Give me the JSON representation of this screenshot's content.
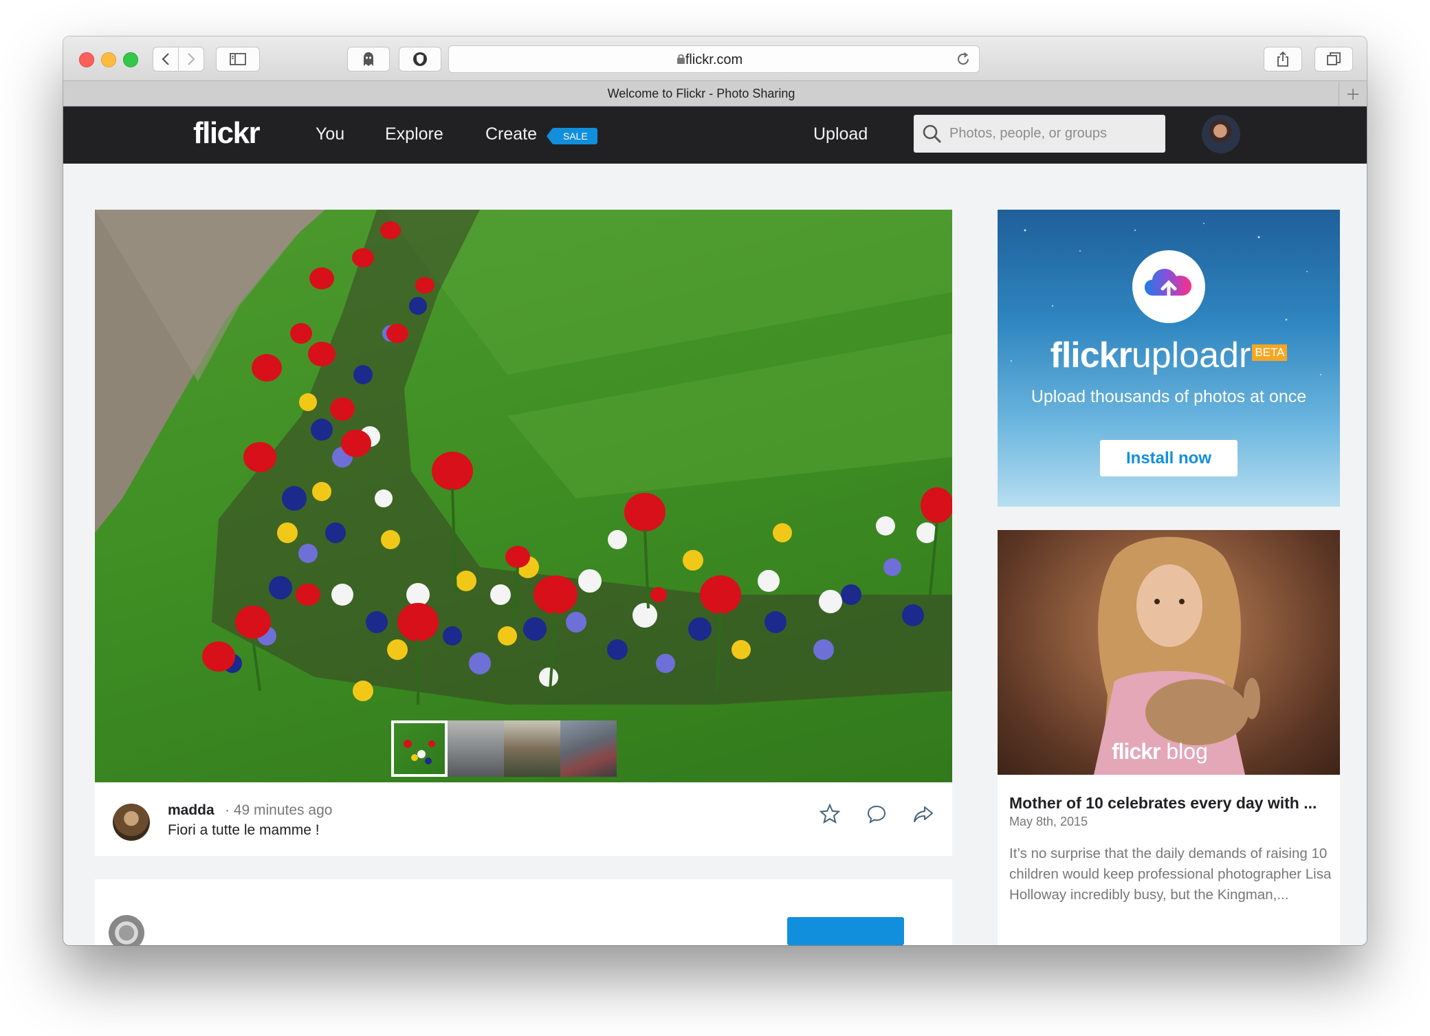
{
  "browser": {
    "url": "flickr.com",
    "tab_title": "Welcome to Flickr - Photo Sharing"
  },
  "nav": {
    "logo": "flickr",
    "you": "You",
    "explore": "Explore",
    "create": "Create",
    "sale_badge": "SALE",
    "upload": "Upload",
    "search_placeholder": "Photos, people, or groups"
  },
  "feed": {
    "author": "madda",
    "time": "· 49 minutes ago",
    "caption": "Fiori a tutte le mamme !",
    "thumbnail_count": 4,
    "active_thumbnail": 1
  },
  "ad": {
    "brand_bold": "flickr",
    "brand_light": "uploadr",
    "beta": "BETA",
    "tagline": "Upload thousands of photos at once",
    "cta": "Install now"
  },
  "blog": {
    "badge_bold": "flickr",
    "badge_light": "blog",
    "title": "Mother of 10 celebrates every day with ...",
    "date": "May 8th, 2015",
    "excerpt": "It’s no surprise that the daily demands of raising 10 children would keep professional photographer Lisa Holloway incredibly busy, but the Kingman,..."
  },
  "colors": {
    "accent": "#128fdc",
    "nav_bg": "#212124",
    "beta": "#f5a623"
  }
}
